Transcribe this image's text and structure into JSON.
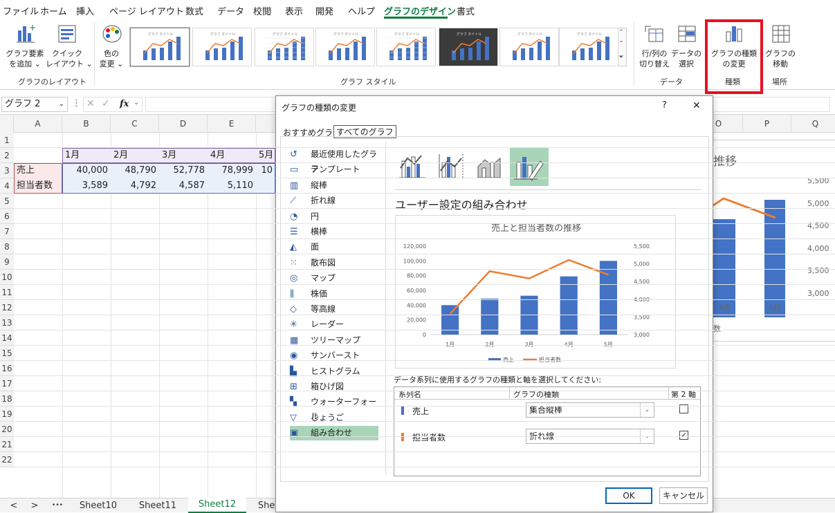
{
  "menu": {
    "items": [
      "ファイル",
      "ホーム",
      "挿入",
      "ページ レイアウト",
      "数式",
      "データ",
      "校閲",
      "表示",
      "開発",
      "ヘルプ",
      "グラフのデザイン",
      "書式"
    ],
    "active_index": 10
  },
  "ribbon": {
    "add_element": "グラフ要素\nを追加 ⌄",
    "quick_layout": "クイック\nレイアウト ⌄",
    "change_color": "色の\n変更 ⌄",
    "group_layout": "グラフのレイアウト",
    "group_style": "グラフ スタイル",
    "switch_row_col": "行/列の\n切り替え",
    "select_data": "データの\n選択",
    "group_data": "データ",
    "change_type": "グラフの種類\nの変更",
    "group_type": "種類",
    "move_chart": "グラフの\n移動",
    "group_location": "場所",
    "thumb_title": "グラフ タイトル"
  },
  "formula": {
    "name_box": "グラフ 2",
    "fx": "fx"
  },
  "sheet": {
    "columns": [
      "A",
      "B",
      "C",
      "D",
      "E",
      "O",
      "P",
      "Q"
    ],
    "rows": [
      "1",
      "2",
      "3",
      "4",
      "5",
      "6",
      "7",
      "8",
      "9",
      "10",
      "11",
      "12",
      "13",
      "14",
      "15",
      "16",
      "17",
      "18",
      "19",
      "20",
      "21",
      "22"
    ],
    "months": [
      "1月",
      "2月",
      "3月",
      "4月",
      "5月"
    ],
    "row_sales_label": "売上",
    "row_staff_label": "担当者数",
    "sales_values": [
      "40,000",
      "48,790",
      "52,778",
      "78,999",
      "10"
    ],
    "staff_values": [
      "3,589",
      "4,792",
      "4,587",
      "5,110"
    ]
  },
  "bg_chart": {
    "title_fragment": "推移",
    "axis_ticks": [
      "5,500",
      "5,000",
      "4,500",
      "4,000",
      "3,500",
      "3,000"
    ],
    "x_labels": [
      "4月",
      "5月"
    ],
    "legend_fragment": "数"
  },
  "dialog": {
    "title": "グラフの種類の変更",
    "help": "?",
    "close": "✕",
    "tab_recommended": "おすすめグラフ",
    "tab_all": "すべてのグラフ",
    "chart_types": [
      "最近使用したグラフ",
      "テンプレート",
      "縦棒",
      "折れ線",
      "円",
      "横棒",
      "面",
      "散布図",
      "マップ",
      "株価",
      "等高線",
      "レーダー",
      "ツリーマップ",
      "サンバースト",
      "ヒストグラム",
      "箱ひげ図",
      "ウォーターフォール",
      "じょうご",
      "組み合わせ"
    ],
    "selected_type_index": 18,
    "section_heading": "ユーザー設定の組み合わせ",
    "series_prompt": "データ系列に使用するグラフの種類と軸を選択してください:",
    "col_series": "系列名",
    "col_type": "グラフの種類",
    "col_secondary": "第 2 軸",
    "series_rows": [
      {
        "name": "売上",
        "type": "集合縦棒",
        "secondary": false,
        "color": "#4472c4"
      },
      {
        "name": "担当者数",
        "type": "折れ線",
        "secondary": true,
        "color": "#ed7d31"
      }
    ],
    "ok": "OK",
    "cancel": "キャンセル"
  },
  "tabs": {
    "items": [
      "Sheet10",
      "Sheet11",
      "Sheet12",
      "Sheet13"
    ],
    "active_index": 2,
    "nav_prev": "<",
    "nav_next": ">",
    "nav_more": "•••"
  },
  "chart_data": {
    "type": "bar",
    "title": "売上と担当者数の推移",
    "categories": [
      "1月",
      "2月",
      "3月",
      "4月",
      "5月"
    ],
    "series": [
      {
        "name": "売上",
        "type": "bar",
        "axis": "primary",
        "color": "#4472c4",
        "values": [
          40000,
          48790,
          52778,
          78999,
          100000
        ]
      },
      {
        "name": "担当者数",
        "type": "line",
        "axis": "secondary",
        "color": "#ed7d31",
        "values": [
          3589,
          4792,
          4587,
          5110,
          4690
        ]
      }
    ],
    "ylim": [
      0,
      120000
    ],
    "y_ticks": [
      "0",
      "20,000",
      "40,000",
      "60,000",
      "80,000",
      "100,000",
      "120,000"
    ],
    "y2lim": [
      3000,
      5500
    ],
    "y2_ticks": [
      "3,000",
      "3,500",
      "4,000",
      "4,500",
      "5,000",
      "5,500"
    ],
    "legend": "bottom",
    "grid": false
  }
}
